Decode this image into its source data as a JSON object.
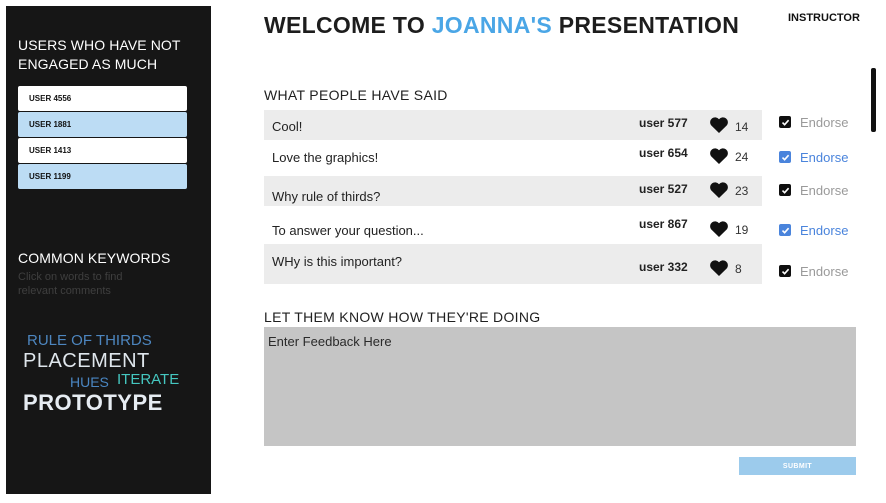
{
  "sidebar": {
    "users_heading": "USERS WHO HAVE NOT ENGAGED AS MUCH",
    "users": [
      {
        "label": "USER 4556",
        "highlighted": false
      },
      {
        "label": "USER 1881",
        "highlighted": true
      },
      {
        "label": "USER 1413",
        "highlighted": false
      },
      {
        "label": "USER 1199",
        "highlighted": true
      }
    ],
    "keywords_heading": "COMMON KEYWORDS",
    "keywords_hint": "Click on words to find relevant comments",
    "keywords": {
      "rule_of_thirds": "RULE OF THIRDS",
      "placement": "PLACEMENT",
      "hues": "HUES",
      "iterate": "ITERATE",
      "prototype": "PROTOTYPE"
    }
  },
  "header": {
    "title_prefix": "WELCOME TO ",
    "title_name": "JOANNA'S",
    "title_suffix": " PRESENTATION",
    "role": "INSTRUCTOR"
  },
  "comments_section": {
    "heading": "WHAT PEOPLE HAVE SAID",
    "endorse_label": "Endorse",
    "comments": [
      {
        "text": "Cool!",
        "user": "user 577",
        "likes": "14",
        "endorsed": false
      },
      {
        "text": "Love the graphics!",
        "user": "user 654",
        "likes": "24",
        "endorsed": true
      },
      {
        "text": "Why rule of thirds?",
        "user": "user 527",
        "likes": "23",
        "endorsed": false
      },
      {
        "text": "To answer your question...",
        "user": "user 867",
        "likes": "19",
        "endorsed": true
      },
      {
        "text": "WHy is this important?",
        "user": "user 332",
        "likes": "8",
        "endorsed": false
      }
    ]
  },
  "feedback": {
    "heading": "LET THEM KNOW HOW THEY'RE DOING",
    "placeholder": "Enter Feedback Here",
    "submit_label": "SUBMIT"
  },
  "colors": {
    "accent": "#4aa6e6",
    "endorse_active": "#4a84dc",
    "sidebar_bg": "#161616",
    "highlight_user": "#bcdcf4",
    "submit_bg": "#9ccbec"
  }
}
